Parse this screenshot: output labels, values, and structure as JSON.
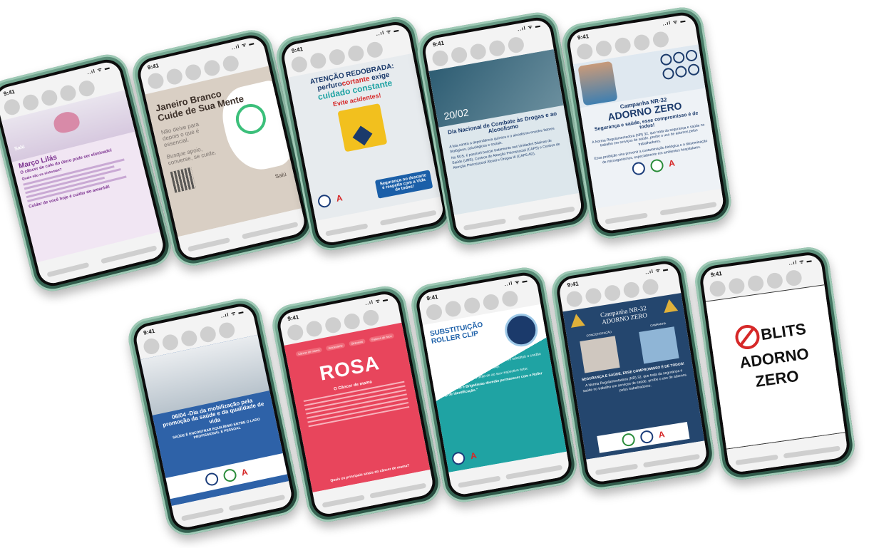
{
  "status": {
    "time": "9:41",
    "signal": "..ıl ᯤ ▬"
  },
  "phones": {
    "p1": {
      "title": "Março Lilás",
      "subtitle": "O câncer de colo do útero pode ser eliminado!",
      "body": "Quais são os sintomas?",
      "footer": "Cuidar de você hoje é cuidar do amanhã!",
      "brand": "Salú"
    },
    "p2": {
      "title": "Janeiro Branco",
      "title2": "Cuide de Sua Mente",
      "line1": "Não deixe para depois o que é essencial.",
      "line2": "Busque apoio, converse, se cuide.",
      "brand": "Salú"
    },
    "p3": {
      "head1": "ATENÇÃO REDOBRADA:",
      "head2a": "perfuro",
      "head2b": "cortante",
      "head2c": " exige",
      "head3": "cuidado constante",
      "alert": "Evite acidentes!",
      "box": "Segurança no descarte é respeito com a Vida de todos!"
    },
    "p4": {
      "date": "20/02",
      "title": "Dia Nacional de Combate às Drogas e ao Alcoolismo",
      "body1": "A luta contra a dependência química e o alcoolismo envolve fatores biológicos, psicológicos e sociais.",
      "body2": "No SUS, é possível buscar tratamento nas Unidades Básicas de Saúde (UBS), Centros de Atenção Psicossocial (CAPS) e Centros de Atenção Psicossocial Álcool e Drogas III (CAPS AD)."
    },
    "p5": {
      "label": "Campanha NR-32",
      "title": "ADORNO ZERO",
      "tagline": "Segurança e saúde, esse compromisso é de todos!",
      "body1": "A Norma Regulamentadora (NR) 32, que trata da segurança e saúde no trabalho em serviços de saúde, proíbe o uso de adornos pelos trabalhadores.",
      "body2": "Essa proibição visa prevenir a contaminação biológica e a disseminação de microrganismos, especialmente em ambientes hospitalares."
    },
    "p6": {
      "title": "06/04 -Dia da mobilização pela promoção da saúde e da qualidade de vida",
      "sub": "SAÚDE É ENCONTRAR EQUILÍBRIO ENTRE O LADO PROFISSIONAL E PESSOAL"
    },
    "p7": {
      "tabs": [
        "Câncer de mama",
        "Autoexame",
        "Sintomas",
        "Fatores de risco"
      ],
      "title": "ROSA",
      "section": "O Câncer de mama",
      "footer": "Quais os principais sinais do câncer de mama?"
    },
    "p8": {
      "title": "SUBSTITUIÇÃO",
      "title2": "ROLLER CLIP",
      "sub": "Comunicado importante aos Colaboradores",
      "body1": "Informamos que todos os colaboradores devem substituir o cordão do crachá pelo novo modelo Roller Clip.",
      "body2": "Para realizar essa troca, dirija-se ao seu respectivo setor.",
      "quote": "\"Os Cipriano e Brigadistas deverão permanecer com o Roller Clip de identificação.\""
    },
    "p9": {
      "title": "Campanha NR-32",
      "title2": "ADORNO ZERO",
      "left": "CONCIENTIZAÇÃO",
      "right": "CAMPANHA",
      "tagline": "SEGURANÇA E SAÚDE, ESSE COMPROMISSO É DE TODOS!",
      "body": "A Norma Regulamentadora (NR) 32, que trata da segurança e saúde no trabalho em serviços de saúde, proíbe o uso de adornos pelos trabalhadores."
    },
    "p10": {
      "word1": "BLITS",
      "word2": "ADORNO",
      "word3": "ZERO"
    }
  },
  "colors": {
    "lilac": "#ead9f0",
    "purple": "#7a2f8e",
    "navy": "#1b3a6b",
    "pink": "#e8455c",
    "teal": "#1fa3a3",
    "red": "#d62828"
  }
}
